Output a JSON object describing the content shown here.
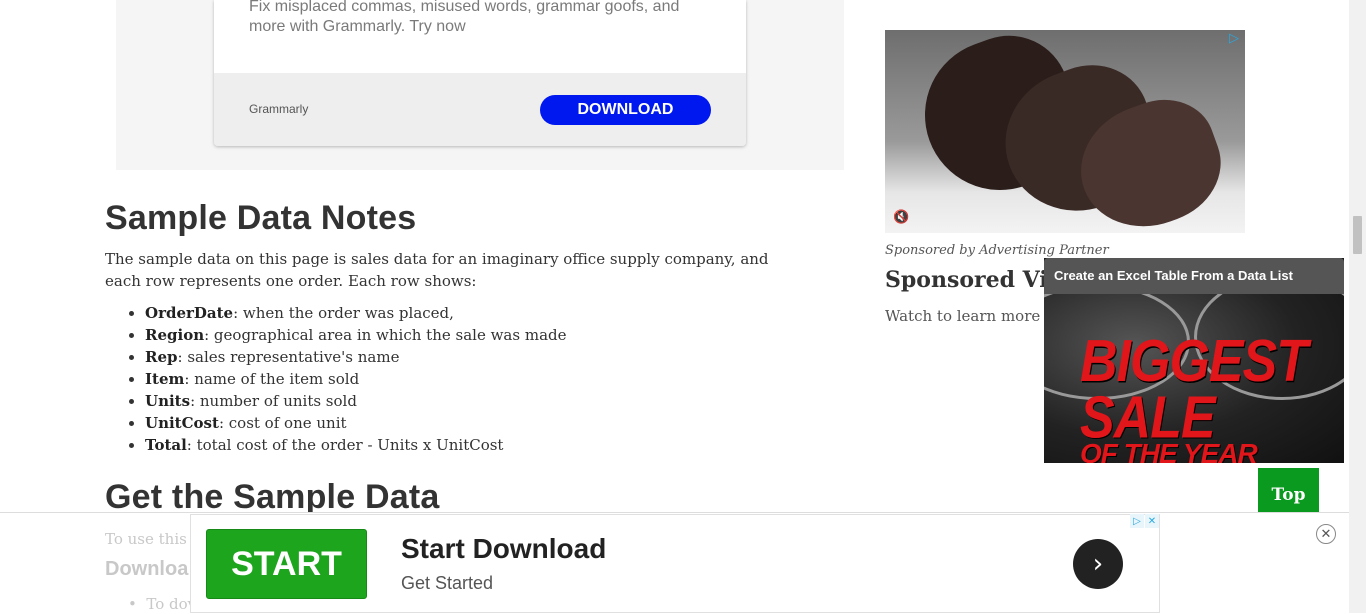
{
  "top_ad": {
    "text": "Fix misplaced commas, misused words, grammar goofs, and more with Grammarly. Try now",
    "brand": "Grammarly",
    "button": "DOWNLOAD"
  },
  "notes": {
    "heading": "Sample Data Notes",
    "intro": "The sample data on this page is sales data for an imaginary office supply company, and each row represents one order. Each row shows:",
    "fields": [
      {
        "name": "OrderDate",
        "desc": ": when the order was placed,"
      },
      {
        "name": "Region",
        "desc": ": geographical area in which the sale was made"
      },
      {
        "name": "Rep",
        "desc": ": sales representative's name"
      },
      {
        "name": "Item",
        "desc": ": name of the item sold"
      },
      {
        "name": "Units",
        "desc": ": number of units sold"
      },
      {
        "name": "UnitCost",
        "desc": ": cost of one unit"
      },
      {
        "name": "Total",
        "desc": ": total cost of the order - Units x UnitCost"
      }
    ]
  },
  "get_data": {
    "heading": "Get the Sample Data",
    "faded_line": "To use this s",
    "faded_heading": "Downloa",
    "faded_bullet": "To dov"
  },
  "sponsored": {
    "caption": "Sponsored by Advertising Partner",
    "title": "Sponsored Vid",
    "subtitle": "Watch to learn more",
    "adchoice_icon": "adchoices-icon",
    "mute_icon": "mute-icon"
  },
  "video": {
    "title": "Create an Excel Table From a Data List",
    "line1": "BIGGEST SALE",
    "line2": "OF THE YEAR"
  },
  "top_button": "Top",
  "bottom_ad": {
    "button": "START",
    "title": "Start Download",
    "subtitle": "Get Started",
    "arrow": "›",
    "badge_play": "▷",
    "badge_close": "✕",
    "close": "✕"
  },
  "colors": {
    "download_blue": "#0018f0",
    "start_green": "#1ea51e",
    "top_green": "#0a9a1f",
    "sale_red": "#e0161b"
  }
}
